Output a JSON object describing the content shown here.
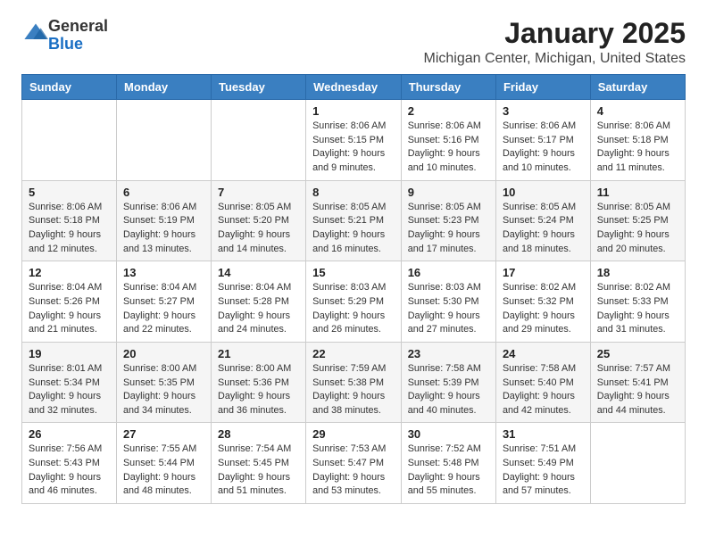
{
  "header": {
    "logo_general": "General",
    "logo_blue": "Blue",
    "month": "January 2025",
    "location": "Michigan Center, Michigan, United States"
  },
  "days_of_week": [
    "Sunday",
    "Monday",
    "Tuesday",
    "Wednesday",
    "Thursday",
    "Friday",
    "Saturday"
  ],
  "weeks": [
    [
      {
        "day": "",
        "info": ""
      },
      {
        "day": "",
        "info": ""
      },
      {
        "day": "",
        "info": ""
      },
      {
        "day": "1",
        "info": "Sunrise: 8:06 AM\nSunset: 5:15 PM\nDaylight: 9 hours\nand 9 minutes."
      },
      {
        "day": "2",
        "info": "Sunrise: 8:06 AM\nSunset: 5:16 PM\nDaylight: 9 hours\nand 10 minutes."
      },
      {
        "day": "3",
        "info": "Sunrise: 8:06 AM\nSunset: 5:17 PM\nDaylight: 9 hours\nand 10 minutes."
      },
      {
        "day": "4",
        "info": "Sunrise: 8:06 AM\nSunset: 5:18 PM\nDaylight: 9 hours\nand 11 minutes."
      }
    ],
    [
      {
        "day": "5",
        "info": "Sunrise: 8:06 AM\nSunset: 5:18 PM\nDaylight: 9 hours\nand 12 minutes."
      },
      {
        "day": "6",
        "info": "Sunrise: 8:06 AM\nSunset: 5:19 PM\nDaylight: 9 hours\nand 13 minutes."
      },
      {
        "day": "7",
        "info": "Sunrise: 8:05 AM\nSunset: 5:20 PM\nDaylight: 9 hours\nand 14 minutes."
      },
      {
        "day": "8",
        "info": "Sunrise: 8:05 AM\nSunset: 5:21 PM\nDaylight: 9 hours\nand 16 minutes."
      },
      {
        "day": "9",
        "info": "Sunrise: 8:05 AM\nSunset: 5:23 PM\nDaylight: 9 hours\nand 17 minutes."
      },
      {
        "day": "10",
        "info": "Sunrise: 8:05 AM\nSunset: 5:24 PM\nDaylight: 9 hours\nand 18 minutes."
      },
      {
        "day": "11",
        "info": "Sunrise: 8:05 AM\nSunset: 5:25 PM\nDaylight: 9 hours\nand 20 minutes."
      }
    ],
    [
      {
        "day": "12",
        "info": "Sunrise: 8:04 AM\nSunset: 5:26 PM\nDaylight: 9 hours\nand 21 minutes."
      },
      {
        "day": "13",
        "info": "Sunrise: 8:04 AM\nSunset: 5:27 PM\nDaylight: 9 hours\nand 22 minutes."
      },
      {
        "day": "14",
        "info": "Sunrise: 8:04 AM\nSunset: 5:28 PM\nDaylight: 9 hours\nand 24 minutes."
      },
      {
        "day": "15",
        "info": "Sunrise: 8:03 AM\nSunset: 5:29 PM\nDaylight: 9 hours\nand 26 minutes."
      },
      {
        "day": "16",
        "info": "Sunrise: 8:03 AM\nSunset: 5:30 PM\nDaylight: 9 hours\nand 27 minutes."
      },
      {
        "day": "17",
        "info": "Sunrise: 8:02 AM\nSunset: 5:32 PM\nDaylight: 9 hours\nand 29 minutes."
      },
      {
        "day": "18",
        "info": "Sunrise: 8:02 AM\nSunset: 5:33 PM\nDaylight: 9 hours\nand 31 minutes."
      }
    ],
    [
      {
        "day": "19",
        "info": "Sunrise: 8:01 AM\nSunset: 5:34 PM\nDaylight: 9 hours\nand 32 minutes."
      },
      {
        "day": "20",
        "info": "Sunrise: 8:00 AM\nSunset: 5:35 PM\nDaylight: 9 hours\nand 34 minutes."
      },
      {
        "day": "21",
        "info": "Sunrise: 8:00 AM\nSunset: 5:36 PM\nDaylight: 9 hours\nand 36 minutes."
      },
      {
        "day": "22",
        "info": "Sunrise: 7:59 AM\nSunset: 5:38 PM\nDaylight: 9 hours\nand 38 minutes."
      },
      {
        "day": "23",
        "info": "Sunrise: 7:58 AM\nSunset: 5:39 PM\nDaylight: 9 hours\nand 40 minutes."
      },
      {
        "day": "24",
        "info": "Sunrise: 7:58 AM\nSunset: 5:40 PM\nDaylight: 9 hours\nand 42 minutes."
      },
      {
        "day": "25",
        "info": "Sunrise: 7:57 AM\nSunset: 5:41 PM\nDaylight: 9 hours\nand 44 minutes."
      }
    ],
    [
      {
        "day": "26",
        "info": "Sunrise: 7:56 AM\nSunset: 5:43 PM\nDaylight: 9 hours\nand 46 minutes."
      },
      {
        "day": "27",
        "info": "Sunrise: 7:55 AM\nSunset: 5:44 PM\nDaylight: 9 hours\nand 48 minutes."
      },
      {
        "day": "28",
        "info": "Sunrise: 7:54 AM\nSunset: 5:45 PM\nDaylight: 9 hours\nand 51 minutes."
      },
      {
        "day": "29",
        "info": "Sunrise: 7:53 AM\nSunset: 5:47 PM\nDaylight: 9 hours\nand 53 minutes."
      },
      {
        "day": "30",
        "info": "Sunrise: 7:52 AM\nSunset: 5:48 PM\nDaylight: 9 hours\nand 55 minutes."
      },
      {
        "day": "31",
        "info": "Sunrise: 7:51 AM\nSunset: 5:49 PM\nDaylight: 9 hours\nand 57 minutes."
      },
      {
        "day": "",
        "info": ""
      }
    ]
  ]
}
